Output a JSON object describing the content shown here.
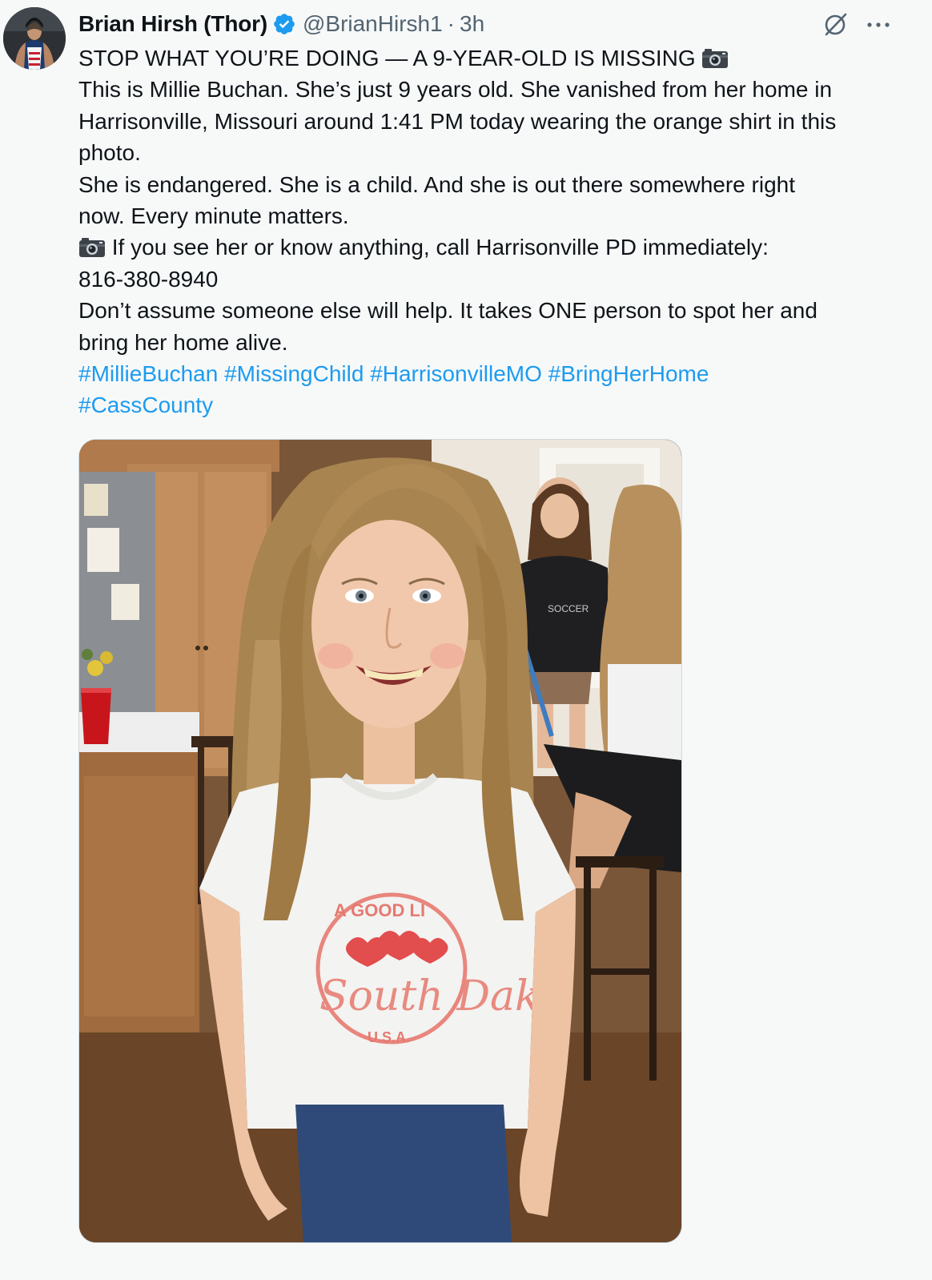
{
  "author": {
    "name": "Brian Hirsh (Thor)",
    "handle": "@BrianHirsh1",
    "separator": "·",
    "time": "3h",
    "verified": true
  },
  "icons": {
    "verified_badge": "verified-badge-icon",
    "grok": "grok-slash-icon",
    "more": "more-dots-icon",
    "camera": "camera-emoji-icon",
    "accent": "#1d9bf0"
  },
  "tweet": {
    "line1": "STOP WHAT YOU’RE DOING — A 9-YEAR-OLD IS MISSING",
    "line2": "This is Millie Buchan. She’s just 9 years old. She vanished from her home in",
    "line3": "Harrisonville, Missouri around 1:41 PM today wearing the orange shirt in this",
    "line4": "photo.",
    "line5": "She is endangered. She is a child. And she is out there somewhere right",
    "line6": "now. Every minute matters.",
    "line7": "If you see her or know anything, call Harrisonville PD immediately:",
    "line8": "816-380-8940",
    "line9": "Don’t assume someone else will help. It takes ONE person to spot her and",
    "line10": "bring her home alive.",
    "hashtags_line1": [
      "#MillieBuchan",
      "#MissingChild",
      "#HarrisonvilleMO",
      "#BringHerHome"
    ],
    "hashtags_line2": [
      "#CassCounty"
    ]
  },
  "media": {
    "shirt_text_top": "A GOOD LI",
    "shirt_text_script": "South Dak",
    "shirt_text_bottom": "U.S.A.",
    "bg_shirt_text": "SOCCER"
  }
}
